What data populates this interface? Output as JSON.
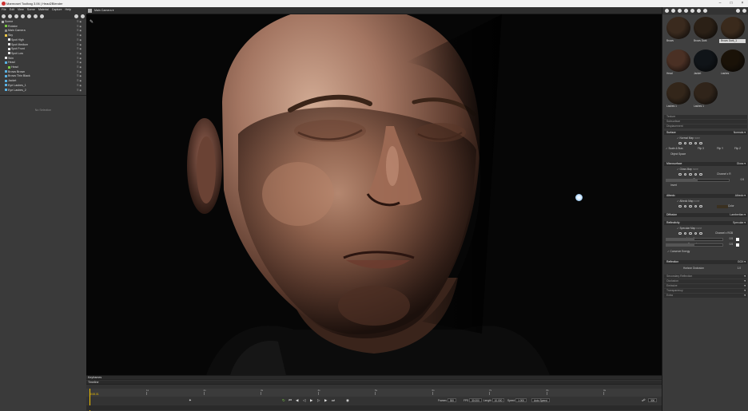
{
  "window": {
    "title": "Marmoset Toolbag 3.06 | Head2Blender"
  },
  "menu": [
    "File",
    "Edit",
    "View",
    "Scene",
    "Material",
    "Capture",
    "Help"
  ],
  "scene_tree": {
    "items": [
      {
        "label": "Scene",
        "indent": 0,
        "color": "#b0b0b0"
      },
      {
        "label": "Rotator",
        "indent": 1,
        "color": "#7ac943"
      },
      {
        "label": "Main Camera",
        "indent": 1,
        "color": "#8a8a8a"
      },
      {
        "label": "Sky",
        "indent": 1,
        "color": "#e8c547"
      },
      {
        "label": "Spot High",
        "indent": 2,
        "color": "#e8e8e8"
      },
      {
        "label": "Spot Medium",
        "indent": 2,
        "color": "#e8e8e8"
      },
      {
        "label": "Spot Front",
        "indent": 2,
        "color": "#e8e8e8"
      },
      {
        "label": "Spot Low",
        "indent": 2,
        "color": "#e8e8e8"
      },
      {
        "label": "Skin",
        "indent": 1,
        "color": "#e8e8e8"
      },
      {
        "label": "Head",
        "indent": 1,
        "color": "#5ab0e0"
      },
      {
        "label": "Head",
        "indent": 2,
        "color": "#7ac943"
      },
      {
        "label": "Brows Brown",
        "indent": 1,
        "color": "#5ab0e0"
      },
      {
        "label": "Brows Thin Black",
        "indent": 1,
        "color": "#5ab0e0"
      },
      {
        "label": "Jacket",
        "indent": 1,
        "color": "#5ab0e0"
      },
      {
        "label": "Eye Lashes_1",
        "indent": 1,
        "color": "#5ab0e0"
      },
      {
        "label": "Eye Lashes_2",
        "indent": 1,
        "color": "#5ab0e0"
      }
    ],
    "visibility_glyph": "☰ ◉"
  },
  "properties": {
    "empty_message": "No Selection"
  },
  "viewport": {
    "camera_label": "Main Camera ▾",
    "tool_glyph": "✎"
  },
  "timeline": {
    "keyframes_label": "Keyframes",
    "timeline_label": "Timeline",
    "current_frame": "0:00.01",
    "ticks": [
      "1s",
      "2s",
      "3s",
      "4s",
      "5s",
      "6s",
      "7s",
      "8s",
      "9s"
    ],
    "frames_label": "Frames",
    "frames_value": "300",
    "fps_label": "FPS",
    "fps_value": "30.000",
    "length_label": "Length",
    "length_value": "10.000",
    "speed_label": "Speed",
    "speed_value": "1.000",
    "auto_speed_label": "Auto Speed",
    "end_value": "300"
  },
  "materials": {
    "items": [
      {
        "label": "Brows",
        "color": "#3a2a1e",
        "selected": false
      },
      {
        "label": "Brows Dark",
        "color": "#2b2016",
        "selected": false
      },
      {
        "label": "Brows Dark_1",
        "color": "#3a2a1c",
        "selected": true
      },
      {
        "label": "Head",
        "color": "#4a3024",
        "selected": false
      },
      {
        "label": "Jacket",
        "color": "#101418",
        "selected": false
      },
      {
        "label": "Lashes",
        "color": "#1a1208",
        "selected": false
      },
      {
        "label": "Lashes 1",
        "color": "#33261a",
        "selected": false
      },
      {
        "label": "Lashes 1",
        "color": "#30241a",
        "selected": false
      }
    ]
  },
  "material_props": {
    "texture": "Texture",
    "subsurface": "Subsurface",
    "displacement": "Displacement",
    "surface": "Surface",
    "surface_mode": "Normals ▾",
    "normal_map": "✓ Normal Map",
    "normal_map_value": "none",
    "scale_bias": "✓ Scale & Bias",
    "flip_x": "Flip X",
    "flip_y": "Flip Y",
    "flip_z": "Flip Z",
    "object_space": "Object Space",
    "microsurface": "Microsurface",
    "microsurface_mode": "Gloss ▾",
    "gloss_map": "✓ Gloss Map",
    "gloss_map_value": "none",
    "channel": "Channel ▾",
    "channel_value": "R",
    "gloss": "Gloss",
    "gloss_value": "0.5",
    "invert": "Invert",
    "albedo": "Albedo",
    "albedo_mode": "Albedo ▾",
    "albedo_map": "✓ Albedo Map",
    "albedo_map_value": "none",
    "color": "Color",
    "diffusion": "Diffusion",
    "diffusion_mode": "Lambertian ▾",
    "reflectivity": "Reflectivity",
    "reflectivity_mode": "Specular ▾",
    "specular_map": "✓ Specular Map",
    "specular_map_value": "none",
    "channel_rgb": "Channel ▾",
    "channel_rgb_value": "RGB",
    "intensity": "Intensity",
    "intensity_value": "0.5",
    "fresnel": "Fresnel",
    "fresnel_value": "0.5",
    "conserve": "✓ Conserve Energy",
    "reflection": "Reflection",
    "reflection_mode": "GGX ▾",
    "horizon": "Horizon Occlusion",
    "horizon_value": "1.0",
    "secondary": "Secondary Reflection",
    "occlusion": "Occlusion",
    "emissive": "Emissive",
    "transparency": "Transparency",
    "extra": "Extra",
    "accent_color": "#555555"
  }
}
